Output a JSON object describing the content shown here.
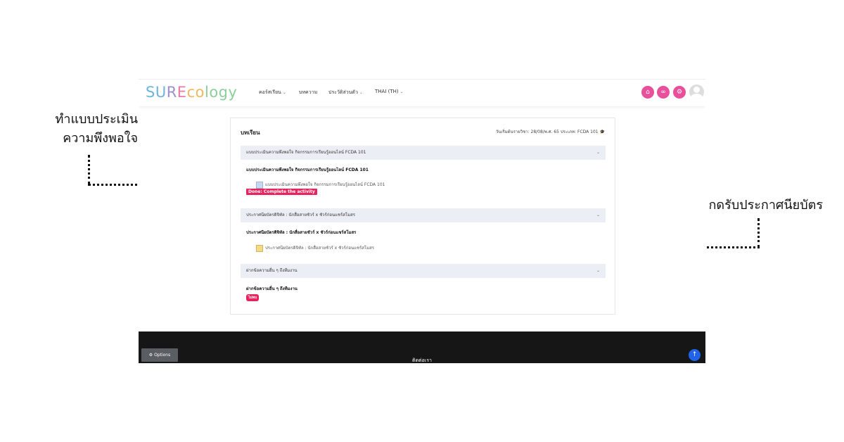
{
  "annotations": {
    "left_line1": "ทำแบบประเมิน",
    "left_line2": "ความพึงพอใจ",
    "right": "กดรับประกาศนียบัตร"
  },
  "navbar": {
    "logo_parts": [
      "SU",
      "R",
      "E",
      "co",
      "logy"
    ],
    "items": [
      {
        "label": "คอร์สเรียน",
        "has_dropdown": true
      },
      {
        "label": "บทความ",
        "has_dropdown": false
      },
      {
        "label": "ประวัติส่วนตัว",
        "has_dropdown": true
      },
      {
        "label": "THAI (TH)",
        "has_dropdown": true
      }
    ],
    "icons": [
      "cart-icon",
      "link-icon",
      "settings-icon"
    ],
    "accent_color": "#e8509b"
  },
  "card": {
    "title": "บทเรียน",
    "meta": "วันเริ่มต้นรายวิชา: 28/08/พ.ศ. 65  ประเภท: FCDA 101 🎓",
    "sections": [
      {
        "header": "แบบประเมินความพึงพอใจ กิจกรรมการเรียนรู้ออนไลน์ FCDA 101",
        "sub": "แบบประเมินความพึงพอใจ กิจกรรมการเรียนรู้ออนไลน์ FCDA 101",
        "activity": "แบบประเมินความพึงพอใจ กิจกรรมการเรียนรู้ออนไลน์ FCDA 101",
        "badge": "Done: Complete the activity"
      },
      {
        "header": "ประกาศนียบัตรดิจิทัล : นักสื่อสายชัวร์ x ชัวร์ก่อนแชร์สโมสร",
        "sub": "ประกาศนียบัตรดิจิทัล : นักสื่อสายชัวร์ x ชัวร์ก่อนแชร์สโมสร",
        "activity": "ประกาศนียบัตรดิจิทัล : นักสื่อสายชัวร์ x ชัวร์ก่อนแชร์สโมสร"
      },
      {
        "header": "ฝากข้อความอื่น ๆ ถึงทีมงาน",
        "sub": "ฝากข้อความอื่น ๆ ถึงทีมงาน",
        "badge": "ไม่พบ"
      }
    ],
    "badge_color": "#e8245e"
  },
  "footer": {
    "options_label": "Options",
    "title": "ติดต่อเรา",
    "up_arrow": "↑"
  }
}
